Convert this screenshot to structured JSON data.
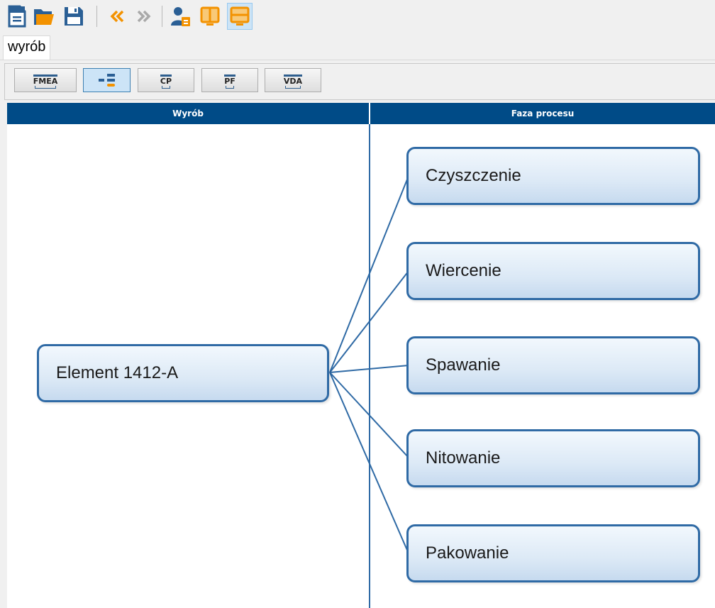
{
  "toolbar": {
    "buttons": [
      {
        "icon": "new-document-icon"
      },
      {
        "icon": "open-folder-icon"
      },
      {
        "icon": "save-icon"
      },
      {
        "icon": "back-icon"
      },
      {
        "icon": "forward-icon"
      },
      {
        "icon": "users-icon"
      },
      {
        "icon": "split-view-vertical-icon"
      },
      {
        "icon": "split-view-horizontal-icon",
        "active": true
      }
    ]
  },
  "tabs": [
    {
      "label": "wyrób",
      "active": true
    }
  ],
  "view_buttons": [
    {
      "label": "FMEA"
    },
    {
      "icon": "tree-view-icon",
      "active": true
    },
    {
      "label": "CP"
    },
    {
      "label": "PF"
    },
    {
      "label": "VDA"
    }
  ],
  "columns": {
    "left_header": "Wyrób",
    "right_header": "Faza procesu"
  },
  "tree": {
    "root": "Element 1412-A",
    "children": [
      "Czyszczenie",
      "Wiercenie",
      "Spawanie",
      "Nitowanie",
      "Pakowanie"
    ]
  },
  "colors": {
    "header_bg": "#004b87",
    "node_border": "#2f6aa5",
    "accent_orange": "#f39200"
  }
}
